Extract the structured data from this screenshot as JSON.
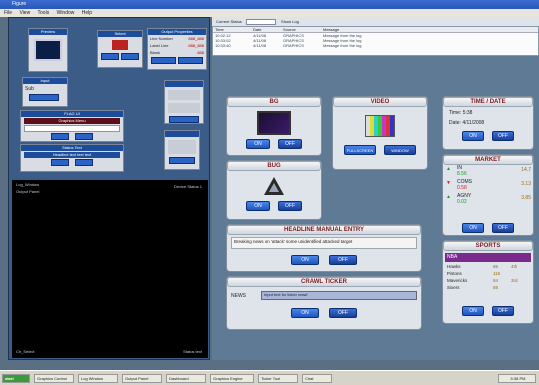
{
  "window": {
    "title": "Figure"
  },
  "menu": [
    "File",
    "View",
    "Tools",
    "Window",
    "Help"
  ],
  "left": {
    "preview_title": "Preview",
    "input_title": "Input",
    "settings": {
      "title": "Output Properties",
      "rows": [
        {
          "k": "Line Number",
          "v": "888_888"
        },
        {
          "k": "Label Line",
          "v": "888_888"
        },
        {
          "k": "Blank",
          "v": "888"
        }
      ]
    },
    "sel_title": "Select",
    "sel_value": "Sub",
    "flag_title": "FLAG UI",
    "flag_sub": "Graphics Menu",
    "flag_value": "",
    "status_title": "Status Text",
    "status_value": "Headline text text text",
    "bottom_labels": [
      "Log_Window",
      "Output Panel"
    ],
    "bottom_right": "Device Status 1",
    "footer_left": "Ch_Select",
    "footer_right": "Status text"
  },
  "log": {
    "filter_label": "Current Status",
    "filter_value": "Show Log",
    "columns": [
      "Time",
      "Date",
      "Source",
      "Message"
    ],
    "rows": [
      [
        "10:32:12",
        "4/11/08",
        "GRAPHICS",
        "Message from the log"
      ],
      [
        "10:33:02",
        "4/11/08",
        "GRAPHICS",
        "Message from the log"
      ],
      [
        "10:33:40",
        "4/11/08",
        "GRAPHICS",
        "Message from the log"
      ]
    ]
  },
  "bg": {
    "title": "BG",
    "on": "ON",
    "off": "OFF"
  },
  "video": {
    "title": "VIDEO",
    "btn1": "FULLSCREEN",
    "btn2": "WINDOW"
  },
  "bug": {
    "title": "BUG",
    "on": "ON",
    "off": "OFF"
  },
  "time": {
    "title": "TIME / DATE",
    "time_label": "Time:",
    "time_value": "5:38",
    "date_label": "Date:",
    "date_value": "4/11/2008",
    "on": "ON",
    "off": "OFF"
  },
  "market": {
    "title": "MARKET",
    "rows": [
      {
        "sym": "IN",
        "sub": "8.56",
        "val": "14.7",
        "dir": "up"
      },
      {
        "sym": "COMS",
        "sub": "0.58",
        "val": "3.13",
        "dir": "down"
      },
      {
        "sym": "AGNY",
        "sub": "0.02",
        "val": "3.85",
        "dir": "up"
      }
    ],
    "on": "ON",
    "off": "OFF"
  },
  "headline": {
    "title": "HEADLINE MANUAL ENTRY",
    "text": "Breaking news on 'attack' some unidentified attacked target",
    "on": "ON",
    "off": "OFF"
  },
  "crawl": {
    "title": "CRAWL TICKER",
    "label": "NEWS",
    "text": "Input text for ticker crawl",
    "on": "ON",
    "off": "OFF"
  },
  "sports": {
    "title": "SPORTS",
    "league": "NBA",
    "rows": [
      {
        "team": "Hawks",
        "score": "86",
        "period": "4th"
      },
      {
        "team": "Pistons",
        "score": "115",
        "period": ""
      },
      {
        "team": "Mavericks",
        "score": "94",
        "period": "3rd"
      },
      {
        "team": "Sixers",
        "score": "88",
        "period": ""
      }
    ],
    "on": "ON",
    "off": "OFF"
  },
  "taskbar": {
    "start": "start",
    "items": [
      "Graphics Control",
      "Log Window",
      "Output Panel",
      "Dashboard",
      "Graphics Engine",
      "Ticker Tool",
      "Chat"
    ],
    "clock": "5:38 PM"
  },
  "colors": {
    "accent": "#1f56c2",
    "header_text": "#7a1a22",
    "up": "#1a9a2a",
    "down": "#d1202a"
  }
}
